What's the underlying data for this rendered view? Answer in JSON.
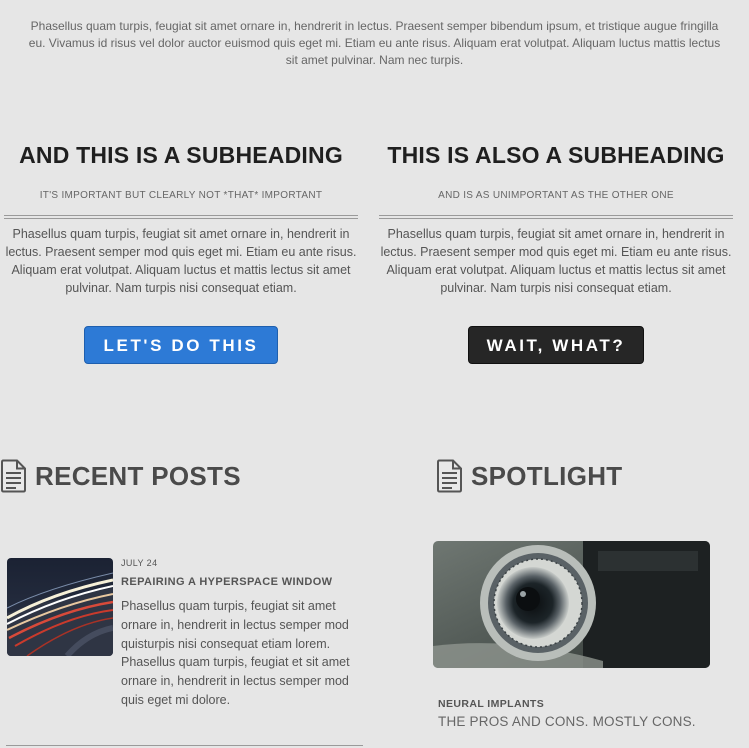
{
  "intro": {
    "text": "Phasellus quam turpis, feugiat sit amet ornare in, hendrerit in lectus. Praesent semper bibendum ipsum, et tristique augue fringilla eu. Vivamus id risus vel dolor auctor euismod quis eget mi. Etiam eu ante risus. Aliquam erat volutpat. Aliquam luctus mattis lectus sit amet pulvinar. Nam nec turpis."
  },
  "features": [
    {
      "heading": "AND THIS IS A SUBHEADING",
      "subtext": "IT'S IMPORTANT BUT CLEARLY NOT *THAT* IMPORTANT",
      "body": "Phasellus quam turpis, feugiat sit amet ornare in, hendrerit in lectus. Praesent semper mod quis eget mi. Etiam eu ante risus. Aliquam erat volutpat. Aliquam luctus et mattis lectus sit amet pulvinar. Nam turpis nisi consequat etiam.",
      "button": "LET'S DO THIS"
    },
    {
      "heading": "THIS IS ALSO A SUBHEADING",
      "subtext": "AND IS AS UNIMPORTANT AS THE OTHER ONE",
      "body": "Phasellus quam turpis, feugiat sit amet ornare in, hendrerit in lectus. Praesent semper mod quis eget mi. Etiam eu ante risus. Aliquam erat volutpat. Aliquam luctus et mattis lectus sit amet pulvinar. Nam turpis nisi consequat etiam.",
      "button": "WAIT, WHAT?"
    }
  ],
  "recent_posts": {
    "title": "RECENT POSTS",
    "icon": "document-icon",
    "items": [
      {
        "date": "JULY 24",
        "title": "REPAIRING A HYPERSPACE WINDOW",
        "excerpt": "Phasellus quam turpis, feugiat sit amet ornare in, hendrerit in lectus semper mod quisturpis nisi consequat etiam lorem. Phasellus quam turpis, feugiat et sit amet ornare in, hendrerit in lectus semper mod quis eget mi dolore.",
        "image": "light-trails-thumbnail"
      }
    ]
  },
  "spotlight": {
    "title": "SPOTLIGHT",
    "icon": "document-icon",
    "image": "vintage-camera-photo",
    "category": "NEURAL IMPLANTS",
    "headline": "THE PROS AND CONS. MOSTLY CONS."
  },
  "colors": {
    "background": "#e6e6e6",
    "button_primary": "#2d7ad6",
    "button_dark": "#262626",
    "heading": "#1f1f1f",
    "text": "#555555"
  }
}
